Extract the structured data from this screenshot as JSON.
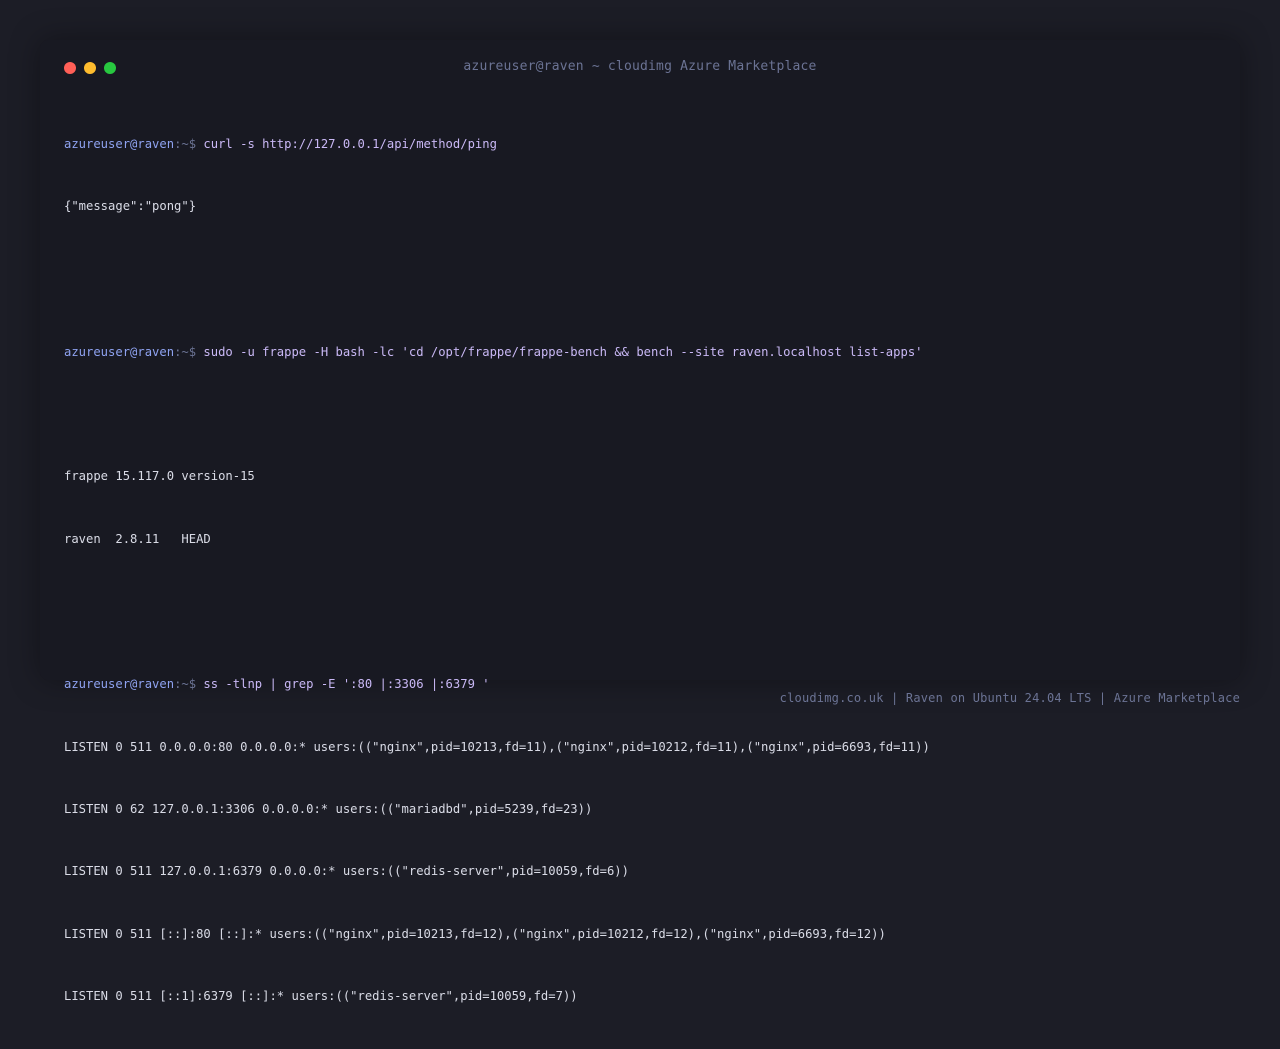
{
  "window": {
    "title": "azureuser@raven ~ cloudimg Azure Marketplace",
    "controls": [
      "close",
      "minimize",
      "zoom"
    ]
  },
  "prompt": {
    "user_host": "azureuser@raven",
    "path_suffix": ":~$ "
  },
  "session": {
    "cmd1": "curl -s http://127.0.0.1/api/method/ping",
    "out1": "{\"message\":\"pong\"}",
    "cmd2": "sudo -u frappe -H bash -lc 'cd /opt/frappe/frappe-bench && bench --site raven.localhost list-apps'",
    "out2": [
      "frappe 15.117.0 version-15",
      "raven  2.8.11   HEAD"
    ],
    "cmd3": "ss -tlnp | grep -E ':80 |:3306 |:6379 '",
    "out3": [
      "LISTEN 0 511 0.0.0.0:80 0.0.0.0:* users:((\"nginx\",pid=10213,fd=11),(\"nginx\",pid=10212,fd=11),(\"nginx\",pid=6693,fd=11))",
      "LISTEN 0 62 127.0.0.1:3306 0.0.0.0:* users:((\"mariadbd\",pid=5239,fd=23))",
      "LISTEN 0 511 127.0.0.1:6379 0.0.0.0:* users:((\"redis-server\",pid=10059,fd=6))",
      "LISTEN 0 511 [::]:80 [::]:* users:((\"nginx\",pid=10213,fd=12),(\"nginx\",pid=10212,fd=12),(\"nginx\",pid=6693,fd=12))",
      "LISTEN 0 511 [::1]:6379 [::]:* users:((\"redis-server\",pid=10059,fd=7))"
    ]
  },
  "footer": {
    "text": "cloudimg.co.uk | Raven on Ubuntu 24.04 LTS | Azure Marketplace"
  },
  "colors": {
    "background": "#1c1d26",
    "terminal_bg": "#181922",
    "prompt_user": "#8ea2f0",
    "command": "#c9b8f5",
    "output": "#d9dbe6",
    "muted": "#6b7394",
    "close": "#ff5f57",
    "minimize": "#febc2e",
    "zoom": "#28c840"
  }
}
